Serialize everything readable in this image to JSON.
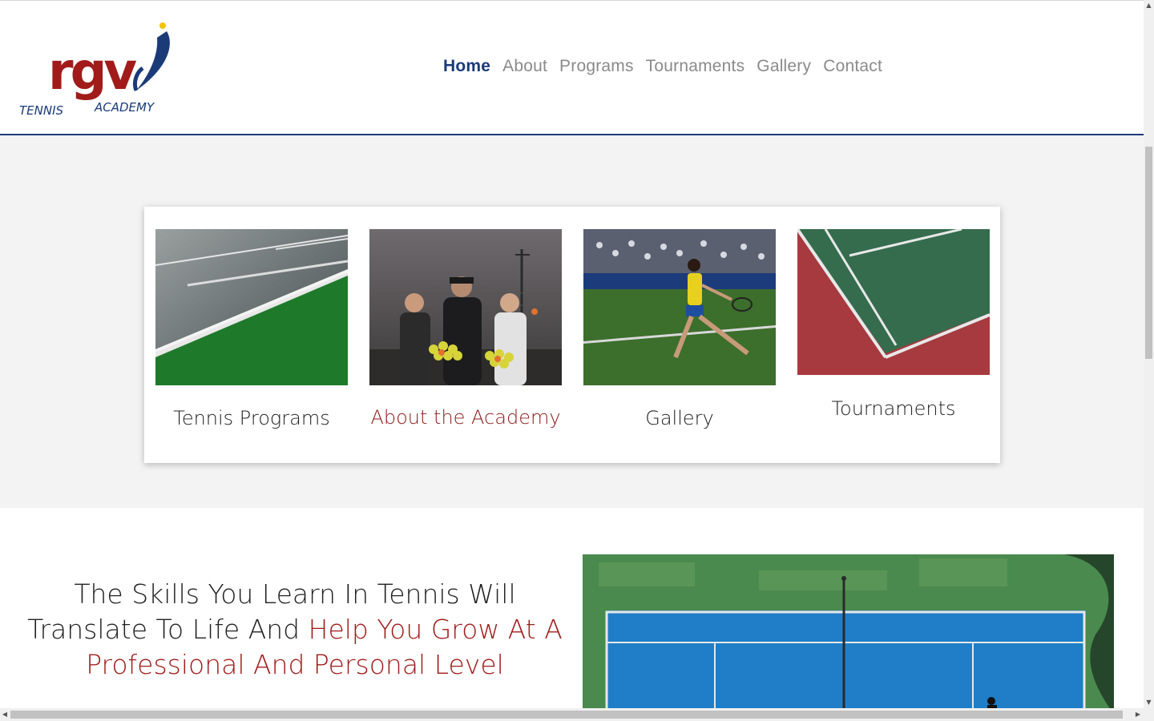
{
  "brand": {
    "logo_mark": "rgv",
    "logo_left": "TENNIS",
    "logo_right": "ACADEMY",
    "colors": {
      "red": "#a11b1b",
      "navy": "#1b3a78",
      "ball": "#f2c400"
    }
  },
  "nav": {
    "items": [
      {
        "label": "Home",
        "active": true
      },
      {
        "label": "About",
        "active": false
      },
      {
        "label": "Programs",
        "active": false
      },
      {
        "label": "Tournaments",
        "active": false
      },
      {
        "label": "Gallery",
        "active": false
      },
      {
        "label": "Contact",
        "active": false
      }
    ]
  },
  "cards": [
    {
      "caption": "Tennis Programs",
      "image": "court-lines-photo"
    },
    {
      "caption": "About the Academy",
      "image": "coach-and-players-photo"
    },
    {
      "caption": "Gallery",
      "image": "player-forehand-photo"
    },
    {
      "caption": "Tournaments",
      "image": "court-corner-photo"
    }
  ],
  "lower": {
    "headline_part1": "The Skills You Learn In Tennis Will Translate To Life And ",
    "headline_part2": "Help You Grow At A Professional And Personal Level",
    "image": "aerial-court-photo"
  },
  "scrollbars": {
    "up": "▲",
    "down": "▼",
    "left": "◀",
    "right": "▶"
  }
}
